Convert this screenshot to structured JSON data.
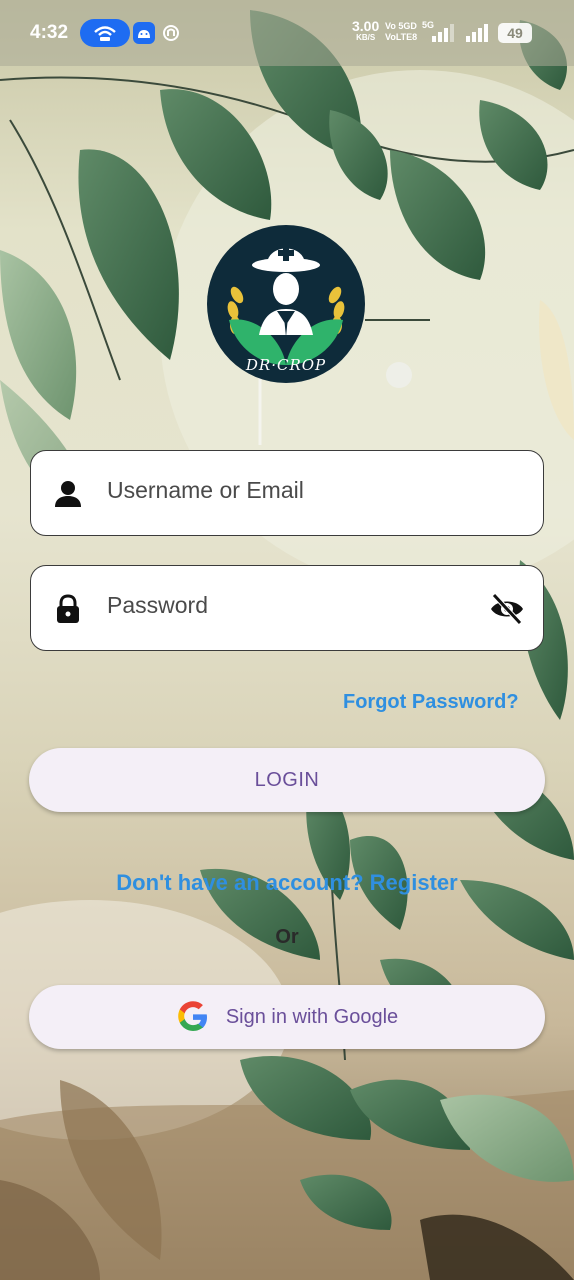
{
  "status_bar": {
    "time": "4:32",
    "net_speed": "3.00",
    "net_unit": "KB/S",
    "volte": "Vo 5GD\nVoLTE8",
    "network": "5G",
    "battery": "49"
  },
  "logo": {
    "text": "DR·CROP"
  },
  "login_form": {
    "username_placeholder": "Username or Email",
    "password_placeholder": "Password",
    "forgot_label": "Forgot Password?",
    "login_label": "LOGIN"
  },
  "register_label": "Don't have an account? Register",
  "or_label": "Or",
  "google_label": "Sign in with Google",
  "colors": {
    "link": "#2f8fe0",
    "button_bg": "#f4eff7",
    "button_text": "#6a4f9a",
    "logo_bg": "#0e2b3a",
    "leaf_green": "#3c6b49"
  }
}
